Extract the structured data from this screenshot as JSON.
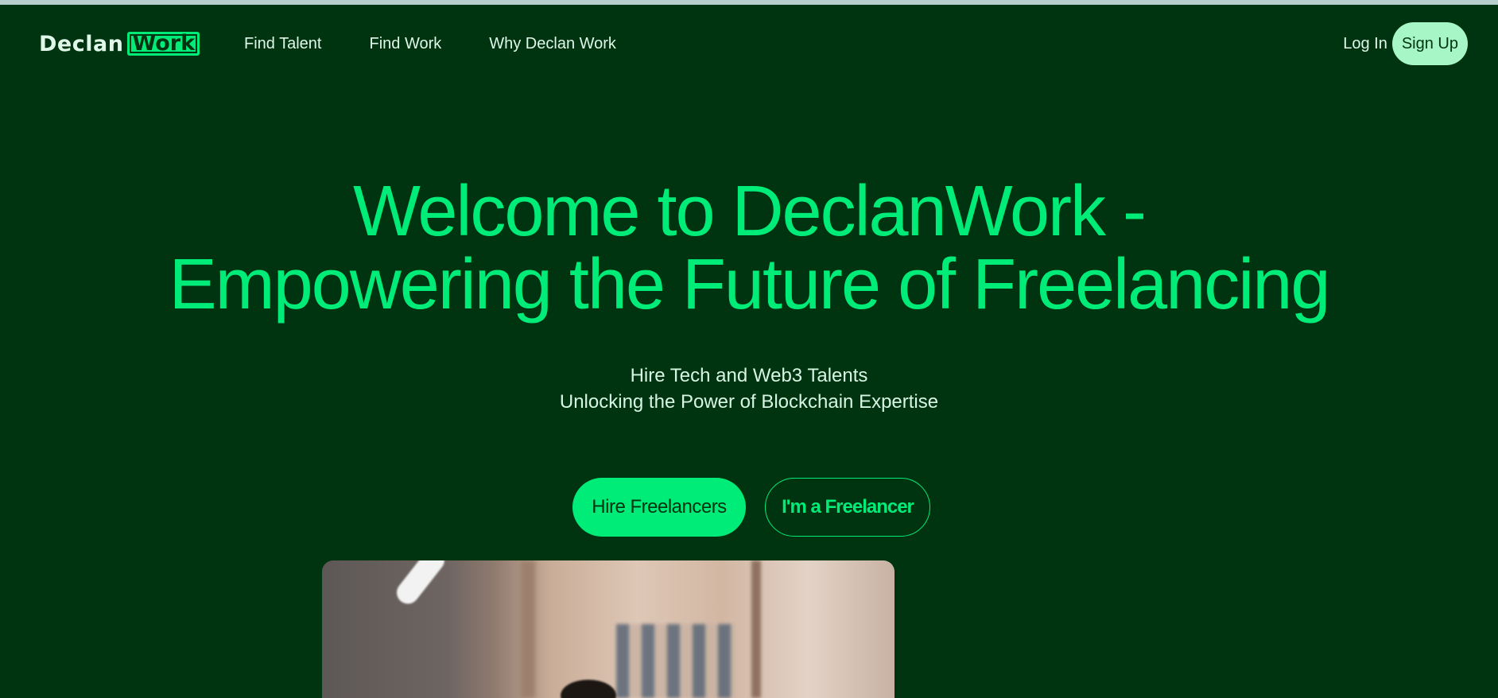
{
  "header": {
    "logo": {
      "part1": "Declan",
      "part2": "Work"
    },
    "nav": [
      "Find Talent",
      "Find Work",
      "Why Declan Work"
    ],
    "login_label": "Log In",
    "signup_label": "Sign Up"
  },
  "hero": {
    "title_line1": "Welcome to DeclanWork -",
    "title_line2": "Empowering the Future of Freelancing",
    "subtitle_line1": "Hire Tech and Web3 Talents",
    "subtitle_line2": "Unlocking the Power of Blockchain Expertise",
    "primary_cta": "Hire Freelancers",
    "secondary_cta": "I'm a Freelancer"
  },
  "colors": {
    "background": "#00330f",
    "accent": "#00ec79",
    "signup_bg": "#a7f7c6",
    "text_light": "#dff7e8"
  }
}
